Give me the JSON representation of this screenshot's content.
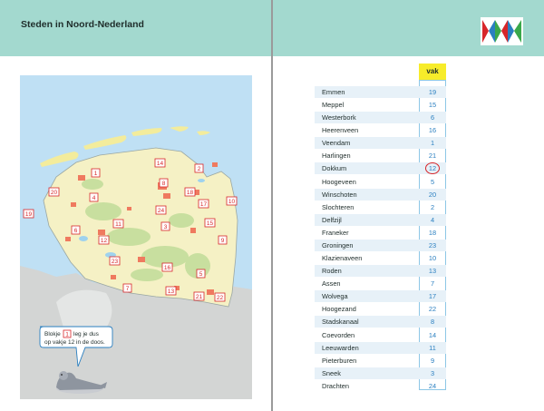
{
  "left_page": {
    "title": "Steden in Noord-Nederland",
    "speech": {
      "before": "Blokje",
      "tile": "1",
      "line1_after": "leg je dus",
      "line2": "op vakje 12 in de doos."
    },
    "map_tiles": [
      "1",
      "2",
      "3",
      "4",
      "5",
      "6",
      "7",
      "8",
      "9",
      "10",
      "11",
      "12",
      "13",
      "14",
      "15",
      "16",
      "17",
      "18",
      "19",
      "20",
      "21",
      "22",
      "23",
      "24"
    ]
  },
  "right_page": {
    "column_header": "vak",
    "logo_colors": [
      "#d7262a",
      "#2a7fc0",
      "#3aa84a"
    ],
    "rows": [
      {
        "city": "Emmen",
        "vak": "19"
      },
      {
        "city": "Meppel",
        "vak": "15"
      },
      {
        "city": "Westerbork",
        "vak": "6"
      },
      {
        "city": "Heerenveen",
        "vak": "16"
      },
      {
        "city": "Veendam",
        "vak": "1"
      },
      {
        "city": "Harlingen",
        "vak": "21"
      },
      {
        "city": "Dokkum",
        "vak": "12",
        "circled": true
      },
      {
        "city": "Hoogeveen",
        "vak": "5"
      },
      {
        "city": "Winschoten",
        "vak": "20"
      },
      {
        "city": "Slochteren",
        "vak": "2"
      },
      {
        "city": "Delfzijl",
        "vak": "4"
      },
      {
        "city": "Franeker",
        "vak": "18"
      },
      {
        "city": "Groningen",
        "vak": "23"
      },
      {
        "city": "Klazienaveen",
        "vak": "10"
      },
      {
        "city": "Roden",
        "vak": "13"
      },
      {
        "city": "Assen",
        "vak": "7"
      },
      {
        "city": "Wolvega",
        "vak": "17"
      },
      {
        "city": "Hoogezand",
        "vak": "22"
      },
      {
        "city": "Stadskanaal",
        "vak": "8"
      },
      {
        "city": "Coevorden",
        "vak": "14"
      },
      {
        "city": "Leeuwarden",
        "vak": "11"
      },
      {
        "city": "Pieterburen",
        "vak": "9"
      },
      {
        "city": "Sneek",
        "vak": "3"
      },
      {
        "city": "Drachten",
        "vak": "24"
      }
    ]
  }
}
